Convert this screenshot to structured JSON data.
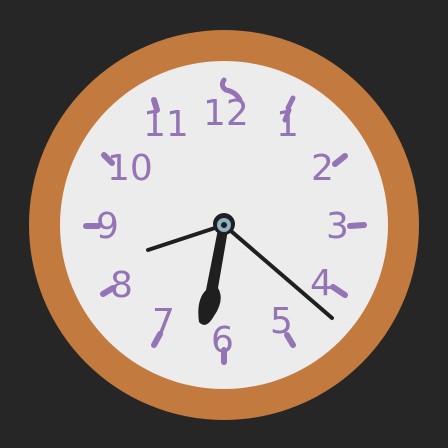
{
  "clock": {
    "numerals": [
      "12",
      "1",
      "2",
      "3",
      "4",
      "5",
      "6",
      "7",
      "8",
      "9",
      "10",
      "11"
    ],
    "time": {
      "hour": 6,
      "minute": 23,
      "second": 41
    },
    "colors": {
      "background": "#262626",
      "rim": "#c27a3e",
      "face": "#ececed",
      "numerals": "#9474b4",
      "hands": "#1f1f1f",
      "center_cap": "#8fb1c4"
    },
    "hand_style": {
      "hour": "thick-tapered",
      "minute": "thin",
      "second": "thin"
    }
  }
}
